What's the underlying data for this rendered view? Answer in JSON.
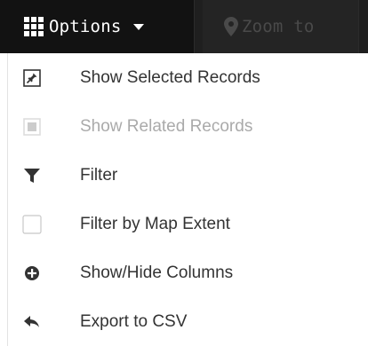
{
  "toolbar": {
    "options_label": "Options",
    "zoom_label": "Zoom to"
  },
  "menu": {
    "items": [
      {
        "label": "Show Selected Records",
        "icon": "pin-box-icon",
        "disabled": false
      },
      {
        "label": "Show Related Records",
        "icon": "square-filled-icon",
        "disabled": true
      },
      {
        "label": "Filter",
        "icon": "funnel-icon",
        "disabled": false
      },
      {
        "label": "Filter by Map Extent",
        "icon": "checkbox-empty-icon",
        "disabled": false
      },
      {
        "label": "Show/Hide Columns",
        "icon": "plus-circle-icon",
        "disabled": false
      },
      {
        "label": "Export to CSV",
        "icon": "reply-arrow-icon",
        "disabled": false
      }
    ]
  },
  "colors": {
    "toolbar_bg": "#1f1f1f",
    "options_bg": "#121212",
    "zoom_text": "#4a4a4a",
    "menu_text": "#333333",
    "disabled_text": "#aaaaaa"
  }
}
